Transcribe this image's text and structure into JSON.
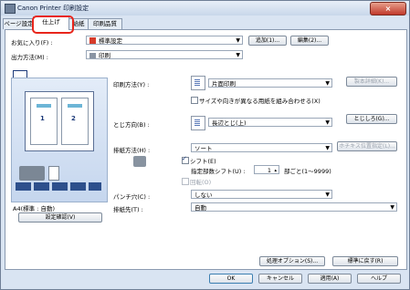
{
  "window": {
    "title": "Canon Printer 印刷設定",
    "close": "×"
  },
  "tabs": [
    "ページ設定",
    "仕上げ",
    "給紙",
    "印刷品質"
  ],
  "favorites": {
    "label": "お気に入り(F) :",
    "value": "標準設定",
    "add": "追加(1)...",
    "edit": "編集(2)..."
  },
  "output": {
    "label": "出力方法(M) :",
    "value": "印刷"
  },
  "print_method": {
    "label": "印刷方法(Y) :",
    "value": "片面印刷",
    "option": "サイズや向きが異なる用紙を組み合わせる(X)",
    "settings": "製本詳細(K)..."
  },
  "binding": {
    "label": "とじ方向(B) :",
    "value": "長辺とじ(上)",
    "margin": "とじしろ(G)..."
  },
  "discharge": {
    "label": "排紙方法(H) :",
    "value": "ソート",
    "staple": "ホチキス位置指定(L)...",
    "shift": "シフト(E)",
    "shift_unit": "指定部数シフト(U) :",
    "shift_num": "1",
    "shift_unit_after": "部ごと(1〜9999)",
    "rotate": "回転(O)"
  },
  "punch": {
    "label": "パンチ穴(C) :",
    "value": "しない"
  },
  "output_tray": {
    "label": "排紙先(T) :",
    "value": "自動"
  },
  "preview": {
    "pages": [
      "1",
      "2"
    ],
    "paper": "A4(標準 : 自動)",
    "confirm": "設定確認(V)"
  },
  "bottom": {
    "options": "処理オプション(S)...",
    "defaults": "標準に戻す(R)"
  },
  "footer": {
    "ok": "OK",
    "cancel": "キャンセル",
    "apply": "適用(A)",
    "help": "ヘルプ"
  }
}
